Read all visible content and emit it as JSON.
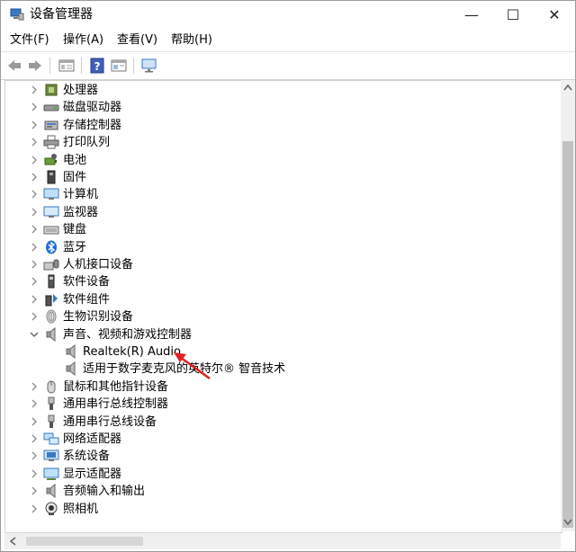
{
  "window": {
    "title": "设备管理器",
    "minimize_glyph": "—",
    "maximize_glyph": "☐",
    "close_glyph": "✕"
  },
  "menu": {
    "items": [
      "文件(F)",
      "操作(A)",
      "查看(V)",
      "帮助(H)"
    ]
  },
  "toolbar": {
    "buttons": [
      "back-icon",
      "forward-icon",
      "properties-icon",
      "help-icon",
      "view-icon",
      "monitor-icon"
    ]
  },
  "tree": {
    "items": [
      {
        "label": "处理器",
        "icon": "processor-icon",
        "state": "collapsed"
      },
      {
        "label": "磁盘驱动器",
        "icon": "disk-drive-icon",
        "state": "collapsed"
      },
      {
        "label": "存储控制器",
        "icon": "storage-controller-icon",
        "state": "collapsed"
      },
      {
        "label": "打印队列",
        "icon": "printer-icon",
        "state": "collapsed"
      },
      {
        "label": "电池",
        "icon": "battery-icon",
        "state": "collapsed"
      },
      {
        "label": "固件",
        "icon": "firmware-icon",
        "state": "collapsed"
      },
      {
        "label": "计算机",
        "icon": "computer-icon",
        "state": "collapsed"
      },
      {
        "label": "监视器",
        "icon": "monitor-icon",
        "state": "collapsed"
      },
      {
        "label": "键盘",
        "icon": "keyboard-icon",
        "state": "collapsed"
      },
      {
        "label": "蓝牙",
        "icon": "bluetooth-icon",
        "state": "collapsed"
      },
      {
        "label": "人机接口设备",
        "icon": "hid-icon",
        "state": "collapsed"
      },
      {
        "label": "软件设备",
        "icon": "software-device-icon",
        "state": "collapsed"
      },
      {
        "label": "软件组件",
        "icon": "software-component-icon",
        "state": "collapsed"
      },
      {
        "label": "生物识别设备",
        "icon": "biometric-icon",
        "state": "collapsed"
      },
      {
        "label": "声音、视频和游戏控制器",
        "icon": "speaker-icon",
        "state": "expanded"
      },
      {
        "label": "Realtek(R) Audio",
        "icon": "speaker-icon",
        "state": "child"
      },
      {
        "label": "适用于数字麦克风的英特尔® 智音技术",
        "icon": "speaker-icon",
        "state": "child"
      },
      {
        "label": "鼠标和其他指针设备",
        "icon": "mouse-icon",
        "state": "collapsed"
      },
      {
        "label": "通用串行总线控制器",
        "icon": "usb-icon",
        "state": "collapsed"
      },
      {
        "label": "通用串行总线设备",
        "icon": "usb-icon",
        "state": "collapsed"
      },
      {
        "label": "网络适配器",
        "icon": "network-icon",
        "state": "collapsed"
      },
      {
        "label": "系统设备",
        "icon": "system-device-icon",
        "state": "collapsed"
      },
      {
        "label": "显示适配器",
        "icon": "display-adapter-icon",
        "state": "collapsed"
      },
      {
        "label": "音频输入和输出",
        "icon": "speaker-icon",
        "state": "collapsed"
      },
      {
        "label": "照相机",
        "icon": "camera-icon",
        "state": "collapsed"
      }
    ]
  },
  "annotation": {
    "color": "#e02020",
    "target": "Realtek(R) Audio"
  }
}
